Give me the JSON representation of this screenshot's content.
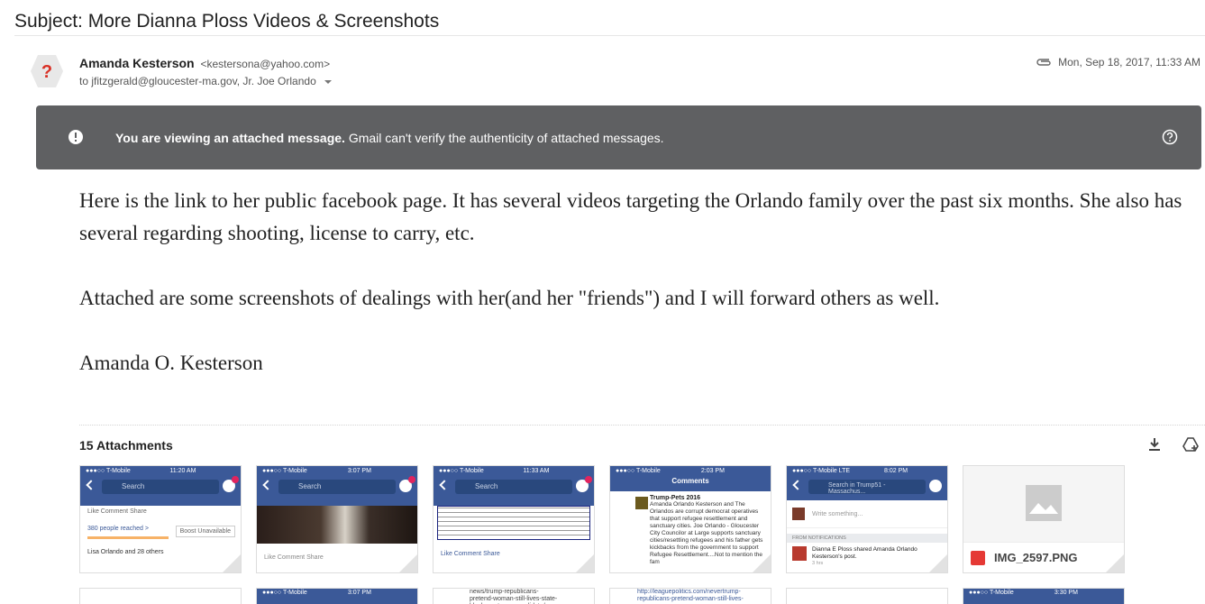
{
  "email": {
    "subject": "Subject: More Dianna Ploss Videos & Screenshots",
    "sender_name": "Amanda Kesterson",
    "sender_email": "<kestersona@yahoo.com>",
    "recipients": "to jfitzgerald@gloucester-ma.gov, Jr. Joe Orlando",
    "date": "Mon, Sep 18, 2017, 11:33 AM",
    "avatar_glyph": "?"
  },
  "banner": {
    "bold": "You are viewing an attached message.",
    "rest": " Gmail can't verify the authenticity of attached messages."
  },
  "body": {
    "p1": "Here is the link to her public facebook page. It has several videos targeting the Orlando family over the past six months. She also has several regarding shooting, license to carry, etc.",
    "p2": "Attached are some screenshots of dealings with her(and her \"friends\") and I will forward others as well.",
    "p3": "Amanda O. Kesterson"
  },
  "attachments": {
    "title": "15 Attachments",
    "items": [
      {
        "status_left": "●●●○○ T-Mobile",
        "time": "11:20 AM",
        "search": "Search",
        "line1": "Like    Comment    Share",
        "line2": "380 people reached >",
        "line3": "Boost Unavailable",
        "line4": "Lisa Orlando and 28 others"
      },
      {
        "status_left": "●●●○○ T-Mobile",
        "time": "3:07 PM",
        "search": "Search",
        "line1": "Like    Comment    Share"
      },
      {
        "status_left": "●●●○○ T-Mobile",
        "time": "11:33 AM",
        "search": "Search",
        "line1": "Like    Comment    Share"
      },
      {
        "status_left": "●●●○○ T-Mobile",
        "time": "2:03 PM",
        "header": "Comments",
        "line1": "Trump-Pets 2016",
        "line2": "Amanda Orlando Kesterson and The Orlandos are corrupt democrat operatives that support refugee resettlement and sanctuary cities. Joe Orlando - Gloucester City Councilor at Large supports sanctuary cities/resettling refugees and his father gets kickbacks from the government to support Refugee Resettlement....Not to mention the fam"
      },
      {
        "status_left": "●●●○○ T-Mobile LTE",
        "time": "8:02 PM",
        "search": "Search in Trump51 - Massachus...",
        "line1": "Write something...",
        "line2": "FROM NOTIFICATIONS",
        "line3": "Dianna E Ploss shared Amanda Orlando Kesterson's post.",
        "line4": "3 hrs"
      },
      {
        "filename": "IMG_2597.PNG"
      }
    ],
    "row2": [
      {
        "text": ""
      },
      {
        "time": "3:07 PM",
        "status_left": "●●●○○ T-Mobile"
      },
      {
        "text": "news/trump-republicans-pretend-woman-still-lives-state-block-pro-trump-candidate/"
      },
      {
        "text": "http://leaguepolitics.com/nevertrump-republicans-pretend-woman-still-lives-"
      },
      {
        "text": ""
      },
      {
        "time": "3:30 PM",
        "status_left": "●●●○○ T-Mobile"
      }
    ]
  }
}
